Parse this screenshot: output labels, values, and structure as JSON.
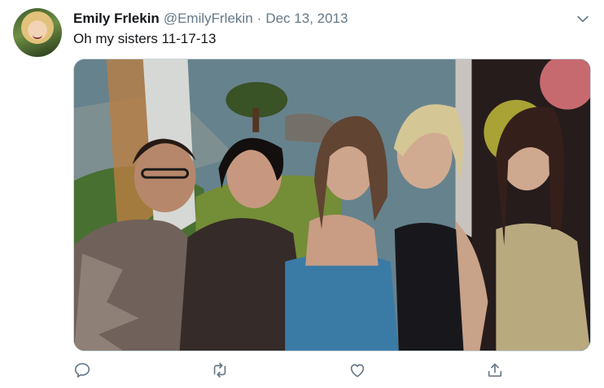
{
  "tweet": {
    "author_name": "Emily Frlekin",
    "handle": "@EmilyFrlekin",
    "separator": "·",
    "date": "Dec 13, 2013",
    "text": "Oh my sisters 11-17-13"
  },
  "icons": {
    "more": "chevron-down-icon",
    "reply": "reply-icon",
    "retweet": "retweet-icon",
    "like": "heart-icon",
    "share": "share-icon"
  },
  "colors": {
    "secondary_text": "#657786",
    "icon": "#657786",
    "border": "#ccd6dd"
  }
}
